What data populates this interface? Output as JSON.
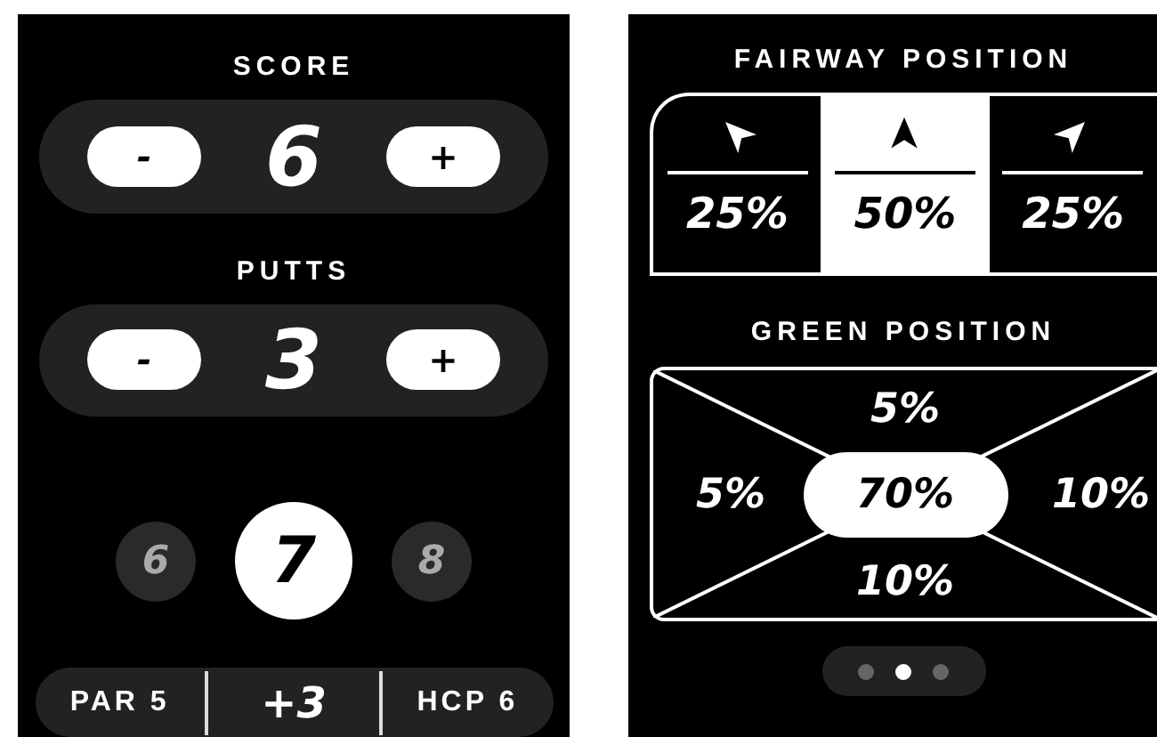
{
  "score_page": {
    "steppers": [
      {
        "title": "SCORE",
        "minus": "-",
        "value": "6",
        "plus": "+"
      },
      {
        "title": "PUTTS",
        "minus": "-",
        "value": "3",
        "plus": "+"
      }
    ],
    "holes": [
      {
        "label": "6",
        "selected": false
      },
      {
        "label": "7",
        "selected": true
      },
      {
        "label": "8",
        "selected": false
      }
    ],
    "summary": [
      {
        "kind": "text",
        "label": "PAR 5"
      },
      {
        "kind": "number",
        "label": "+3"
      },
      {
        "kind": "text",
        "label": "HCP 6"
      }
    ]
  },
  "position_page": {
    "fairway": {
      "title": "FAIRWAY POSITION",
      "options": [
        {
          "kind": "left",
          "value": "25%",
          "selected": false
        },
        {
          "kind": "center",
          "value": "50%",
          "selected": true
        },
        {
          "kind": "right",
          "value": "25%",
          "selected": false
        }
      ]
    },
    "green": {
      "title": "GREEN POSITION",
      "zones": [
        {
          "kind": "top",
          "value": "5%"
        },
        {
          "kind": "left",
          "value": "5%"
        },
        {
          "kind": "center",
          "value": "70%"
        },
        {
          "kind": "right",
          "value": "10%"
        },
        {
          "kind": "bottom",
          "value": "10%"
        }
      ]
    },
    "pager": [
      {
        "selected": false
      },
      {
        "selected": true
      },
      {
        "selected": false
      }
    ]
  }
}
